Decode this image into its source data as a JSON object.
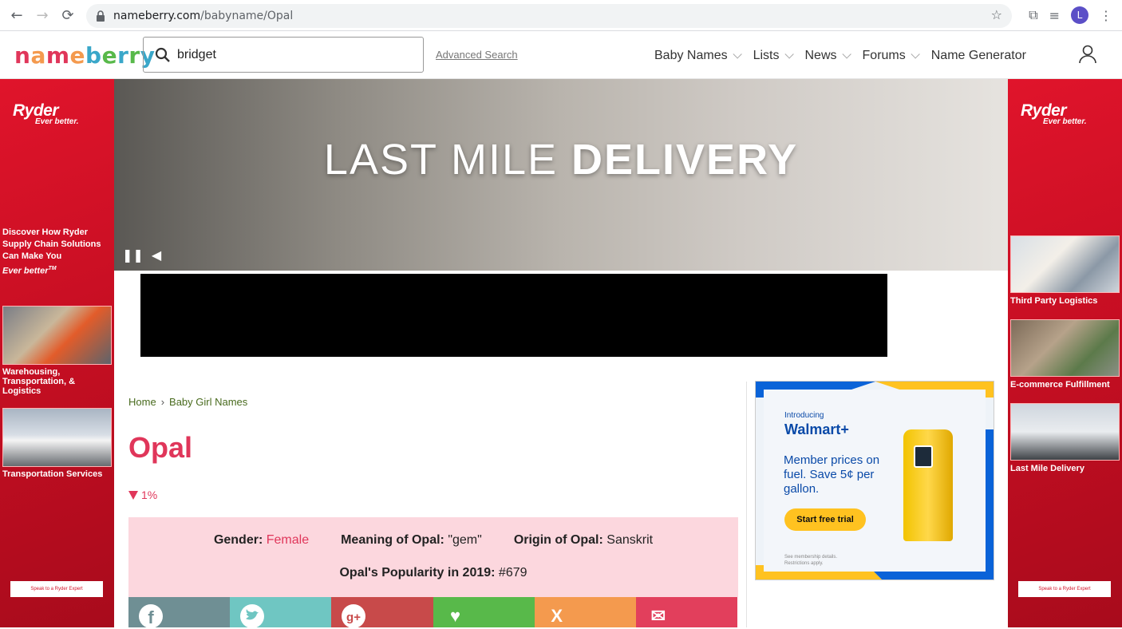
{
  "browser": {
    "back_glyph": "←",
    "forward_glyph": "→",
    "reload_glyph": "⟳",
    "url_domain": "nameberry.com",
    "url_path": "/babyname/Opal",
    "star_glyph": "☆",
    "extensions_glyph": "⧉",
    "readinglist_glyph": "≡",
    "avatar_letter": "L",
    "menu_glyph": "⋮"
  },
  "header": {
    "logo_letters": [
      "n",
      "a",
      "m",
      "e",
      "b",
      "e",
      "r",
      "r",
      "y"
    ],
    "logo_colors": [
      "#e0365a",
      "#f49a4e",
      "#e0365a",
      "#f49a4e",
      "#3aa7c9",
      "#58b94a",
      "#3aa7c9",
      "#58b94a",
      "#3aa7c9"
    ],
    "search_value": "bridget",
    "advanced_search": "Advanced Search",
    "nav": [
      {
        "label": "Baby Names",
        "has_menu": true
      },
      {
        "label": "Lists",
        "has_menu": true
      },
      {
        "label": "News",
        "has_menu": true
      },
      {
        "label": "Forums",
        "has_menu": true
      },
      {
        "label": "Name Generator",
        "has_menu": false
      }
    ]
  },
  "left_ad": {
    "brand": "Ryder",
    "tagline": "Ever better.",
    "copy_lines": [
      "Discover How Ryder",
      "Supply Chain Solutions",
      "Can Make You"
    ],
    "copy_italic": "Ever better",
    "copy_tm": "TM",
    "captions": [
      "Warehousing, Transportation, & Logistics",
      "Transportation Services"
    ],
    "cta": "Speak to a Ryder Expert"
  },
  "right_ad": {
    "brand": "Ryder",
    "tagline": "Ever better.",
    "captions": [
      "Third Party Logistics",
      "E-commerce Fulfillment",
      "Last Mile Delivery"
    ],
    "cta": "Speak to a Ryder Expert"
  },
  "video": {
    "title_light": "LAST MILE ",
    "title_bold": "DELIVERY",
    "pause_glyph": "❚❚",
    "mute_glyph": "◀"
  },
  "breadcrumb": {
    "home": "Home",
    "sep": "›",
    "category": "Baby Girl Names"
  },
  "name": {
    "title": "Opal",
    "trend": "1%"
  },
  "info": {
    "gender_label": "Gender:",
    "gender_value": "Female",
    "meaning_label": "Meaning of Opal:",
    "meaning_value": "\"gem\"",
    "origin_label": "Origin of Opal:",
    "origin_value": "Sanskrit",
    "popularity_label": "Opal's Popularity in 2019:",
    "popularity_value": "#679"
  },
  "share": [
    {
      "name": "facebook",
      "glyph": "f"
    },
    {
      "name": "twitter",
      "glyph": "t"
    },
    {
      "name": "google-plus",
      "glyph": "g+"
    },
    {
      "name": "like",
      "glyph": "♥"
    },
    {
      "name": "x",
      "glyph": "X"
    },
    {
      "name": "email",
      "glyph": "✉"
    }
  ],
  "walmart_ad": {
    "intro": "Introducing",
    "brand": "Walmart+",
    "copy": "Member prices on fuel. Save 5¢ per gallon.",
    "cta": "Start free trial",
    "fine1": "See membership details.",
    "fine2": "Restrictions apply."
  }
}
